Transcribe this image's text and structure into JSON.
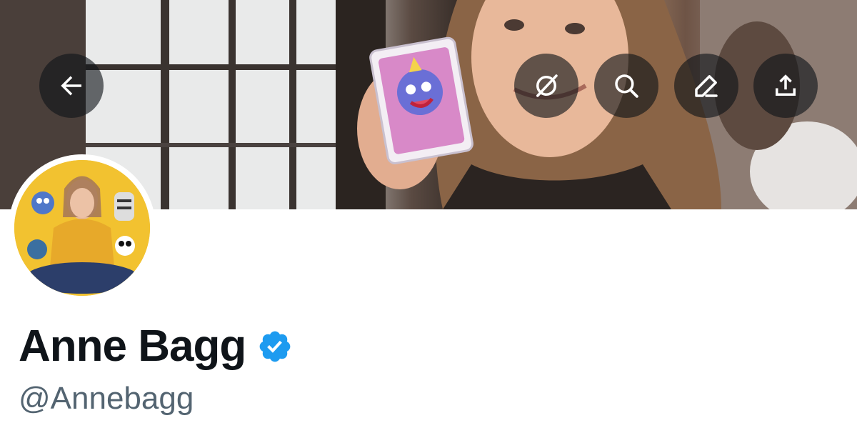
{
  "header": {
    "back_button": {
      "icon": "arrow-left-icon"
    },
    "actions": [
      {
        "name": "grok-button",
        "icon": "grok-slash-circle-icon"
      },
      {
        "name": "search-button",
        "icon": "search-icon"
      },
      {
        "name": "edit-button",
        "icon": "pencil-icon"
      },
      {
        "name": "share-button",
        "icon": "share-upload-icon"
      }
    ]
  },
  "profile": {
    "display_name": "Anne Bagg",
    "handle": "@Annebagg",
    "verified": true,
    "verified_icon": "verified-badge-icon"
  },
  "colors": {
    "text_primary": "#0f1419",
    "text_secondary": "#536471",
    "verified_blue": "#1d9bf0",
    "icon_button_bg": "rgba(15,20,25,0.62)",
    "avatar_bg": "#f2c230"
  }
}
